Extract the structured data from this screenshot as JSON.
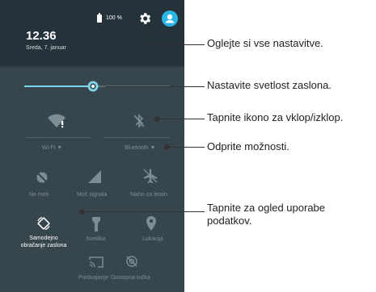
{
  "status_bar": {
    "battery_percent": "100 %"
  },
  "header": {
    "time": "12.36",
    "date": "Sreda, 7. januar"
  },
  "brightness": {
    "level": 0.47
  },
  "tiles_row1": [
    {
      "label": "Wi-Fi",
      "icon": "wifi-icon",
      "dropdown": true
    },
    {
      "label": "Bluetooth",
      "icon": "bluetooth-off-icon",
      "dropdown": true
    }
  ],
  "tiles_row2": [
    {
      "label": "Ne moti",
      "icon": "do-not-disturb-icon"
    },
    {
      "label": "Moč signala",
      "icon": "signal-strength-icon"
    },
    {
      "label": "Način za letalo",
      "icon": "airplane-icon"
    }
  ],
  "tiles_row3": [
    {
      "label_line1": "Samodejno",
      "label_line2": "obračanje zaslona",
      "icon": "auto-rotate-icon"
    },
    {
      "label": "Svetilka",
      "icon": "flashlight-icon"
    },
    {
      "label": "Lokacija",
      "icon": "location-icon"
    }
  ],
  "tiles_row4": [
    {
      "label": "Predvajanje",
      "icon": "cast-icon"
    },
    {
      "label": "Dostopna točka",
      "icon": "hotspot-icon"
    }
  ],
  "callouts": {
    "settings": "Oglejte si vse nastavitve.",
    "brightness": "Nastavite svetlost zaslona.",
    "toggle": "Tapnite ikono za vklop/izklop.",
    "options": "Odprite možnosti.",
    "data_line1": "Tapnite za ogled uporabe",
    "data_line2": "podatkov."
  },
  "colors": {
    "accent": "#29b6e6",
    "panel": "#37454c",
    "header": "#26323a"
  }
}
